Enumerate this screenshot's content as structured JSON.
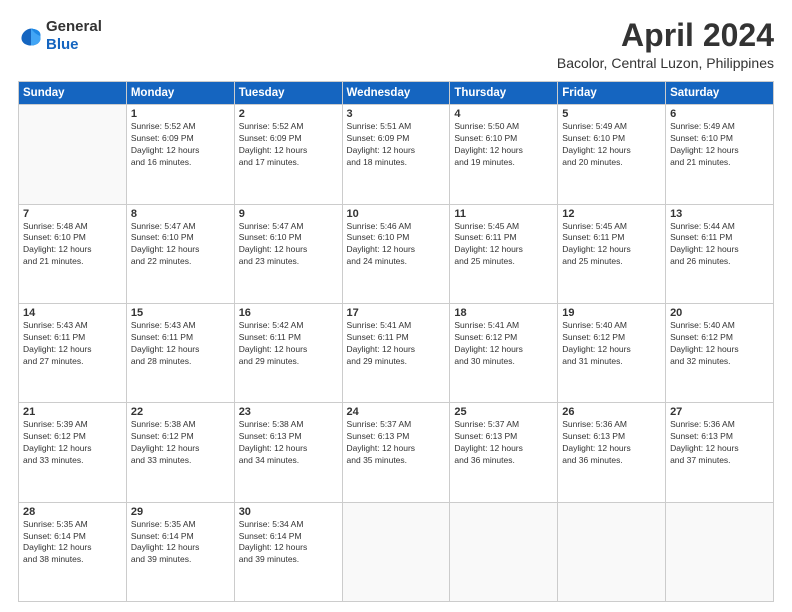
{
  "logo": {
    "text_general": "General",
    "text_blue": "Blue"
  },
  "title": "April 2024",
  "location": "Bacolor, Central Luzon, Philippines",
  "days_of_week": [
    "Sunday",
    "Monday",
    "Tuesday",
    "Wednesday",
    "Thursday",
    "Friday",
    "Saturday"
  ],
  "weeks": [
    [
      {
        "day": "",
        "info": ""
      },
      {
        "day": "1",
        "info": "Sunrise: 5:52 AM\nSunset: 6:09 PM\nDaylight: 12 hours\nand 16 minutes."
      },
      {
        "day": "2",
        "info": "Sunrise: 5:52 AM\nSunset: 6:09 PM\nDaylight: 12 hours\nand 17 minutes."
      },
      {
        "day": "3",
        "info": "Sunrise: 5:51 AM\nSunset: 6:09 PM\nDaylight: 12 hours\nand 18 minutes."
      },
      {
        "day": "4",
        "info": "Sunrise: 5:50 AM\nSunset: 6:10 PM\nDaylight: 12 hours\nand 19 minutes."
      },
      {
        "day": "5",
        "info": "Sunrise: 5:49 AM\nSunset: 6:10 PM\nDaylight: 12 hours\nand 20 minutes."
      },
      {
        "day": "6",
        "info": "Sunrise: 5:49 AM\nSunset: 6:10 PM\nDaylight: 12 hours\nand 21 minutes."
      }
    ],
    [
      {
        "day": "7",
        "info": "Sunrise: 5:48 AM\nSunset: 6:10 PM\nDaylight: 12 hours\nand 21 minutes."
      },
      {
        "day": "8",
        "info": "Sunrise: 5:47 AM\nSunset: 6:10 PM\nDaylight: 12 hours\nand 22 minutes."
      },
      {
        "day": "9",
        "info": "Sunrise: 5:47 AM\nSunset: 6:10 PM\nDaylight: 12 hours\nand 23 minutes."
      },
      {
        "day": "10",
        "info": "Sunrise: 5:46 AM\nSunset: 6:10 PM\nDaylight: 12 hours\nand 24 minutes."
      },
      {
        "day": "11",
        "info": "Sunrise: 5:45 AM\nSunset: 6:11 PM\nDaylight: 12 hours\nand 25 minutes."
      },
      {
        "day": "12",
        "info": "Sunrise: 5:45 AM\nSunset: 6:11 PM\nDaylight: 12 hours\nand 25 minutes."
      },
      {
        "day": "13",
        "info": "Sunrise: 5:44 AM\nSunset: 6:11 PM\nDaylight: 12 hours\nand 26 minutes."
      }
    ],
    [
      {
        "day": "14",
        "info": "Sunrise: 5:43 AM\nSunset: 6:11 PM\nDaylight: 12 hours\nand 27 minutes."
      },
      {
        "day": "15",
        "info": "Sunrise: 5:43 AM\nSunset: 6:11 PM\nDaylight: 12 hours\nand 28 minutes."
      },
      {
        "day": "16",
        "info": "Sunrise: 5:42 AM\nSunset: 6:11 PM\nDaylight: 12 hours\nand 29 minutes."
      },
      {
        "day": "17",
        "info": "Sunrise: 5:41 AM\nSunset: 6:11 PM\nDaylight: 12 hours\nand 29 minutes."
      },
      {
        "day": "18",
        "info": "Sunrise: 5:41 AM\nSunset: 6:12 PM\nDaylight: 12 hours\nand 30 minutes."
      },
      {
        "day": "19",
        "info": "Sunrise: 5:40 AM\nSunset: 6:12 PM\nDaylight: 12 hours\nand 31 minutes."
      },
      {
        "day": "20",
        "info": "Sunrise: 5:40 AM\nSunset: 6:12 PM\nDaylight: 12 hours\nand 32 minutes."
      }
    ],
    [
      {
        "day": "21",
        "info": "Sunrise: 5:39 AM\nSunset: 6:12 PM\nDaylight: 12 hours\nand 33 minutes."
      },
      {
        "day": "22",
        "info": "Sunrise: 5:38 AM\nSunset: 6:12 PM\nDaylight: 12 hours\nand 33 minutes."
      },
      {
        "day": "23",
        "info": "Sunrise: 5:38 AM\nSunset: 6:13 PM\nDaylight: 12 hours\nand 34 minutes."
      },
      {
        "day": "24",
        "info": "Sunrise: 5:37 AM\nSunset: 6:13 PM\nDaylight: 12 hours\nand 35 minutes."
      },
      {
        "day": "25",
        "info": "Sunrise: 5:37 AM\nSunset: 6:13 PM\nDaylight: 12 hours\nand 36 minutes."
      },
      {
        "day": "26",
        "info": "Sunrise: 5:36 AM\nSunset: 6:13 PM\nDaylight: 12 hours\nand 36 minutes."
      },
      {
        "day": "27",
        "info": "Sunrise: 5:36 AM\nSunset: 6:13 PM\nDaylight: 12 hours\nand 37 minutes."
      }
    ],
    [
      {
        "day": "28",
        "info": "Sunrise: 5:35 AM\nSunset: 6:14 PM\nDaylight: 12 hours\nand 38 minutes."
      },
      {
        "day": "29",
        "info": "Sunrise: 5:35 AM\nSunset: 6:14 PM\nDaylight: 12 hours\nand 39 minutes."
      },
      {
        "day": "30",
        "info": "Sunrise: 5:34 AM\nSunset: 6:14 PM\nDaylight: 12 hours\nand 39 minutes."
      },
      {
        "day": "",
        "info": ""
      },
      {
        "day": "",
        "info": ""
      },
      {
        "day": "",
        "info": ""
      },
      {
        "day": "",
        "info": ""
      }
    ]
  ]
}
